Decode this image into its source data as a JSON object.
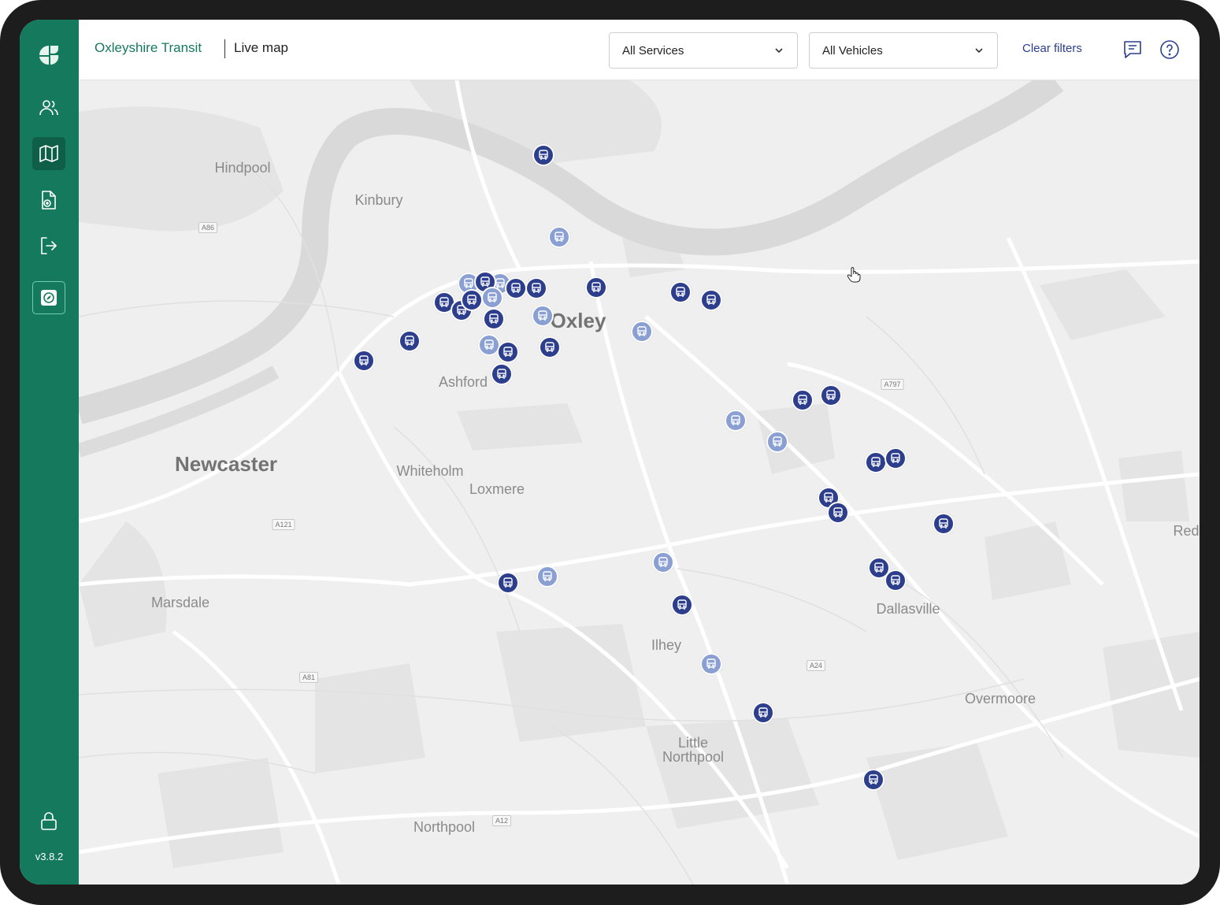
{
  "header": {
    "brand": "Oxleyshire Transit",
    "page_title": "Live map",
    "services_select": "All Services",
    "vehicles_select": "All Vehicles",
    "clear_filters": "Clear filters"
  },
  "sidebar": {
    "items": [
      "logo-icon",
      "users-icon",
      "map-icon",
      "add-document-icon",
      "logout-icon",
      "compass-icon",
      "lock-icon"
    ],
    "version": "v3.8.2"
  },
  "map": {
    "places": {
      "hindpool": "Hindpool",
      "kinbury": "Kinbury",
      "oxley": "Oxley",
      "ashford": "Ashford",
      "newcaster": "Newcaster",
      "whiteholm": "Whiteholm",
      "loxmere": "Loxmere",
      "marsdale": "Marsdale",
      "ilhey": "Ilhey",
      "dallasville": "Dallasville",
      "overmoore": "Overmoore",
      "little_northpool": "Little\nNorthpool",
      "northpool": "Northpool",
      "red": "Red"
    },
    "roads": {
      "a86": "A86",
      "a121": "A121",
      "a81": "A81",
      "a797": "A797",
      "a24": "A24",
      "a12": "A12"
    },
    "vehicle_status_colors": {
      "active": "#2d3e8c",
      "inactive": "#8a9fd2"
    }
  }
}
